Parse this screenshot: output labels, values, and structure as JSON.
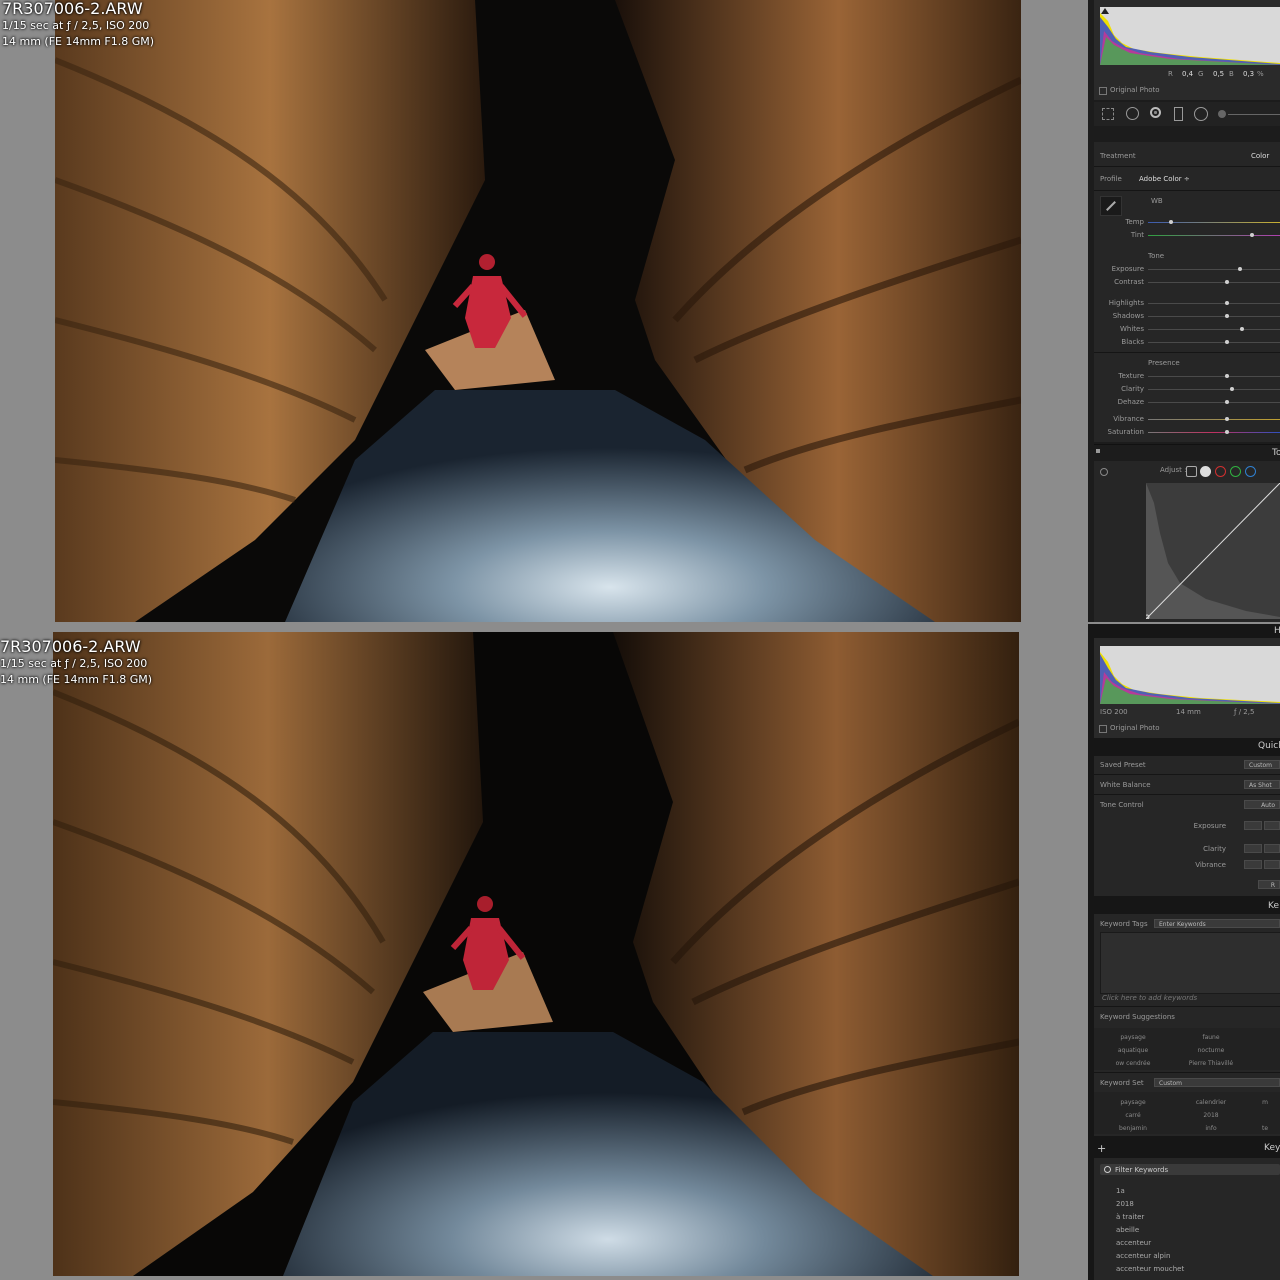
{
  "photos": [
    {
      "filename": "7R307006-2.ARW",
      "exposure": "1/15 sec at ƒ / 2,5, ISO 200",
      "lens": "14 mm (FE 14mm F1.8 GM)"
    },
    {
      "filename": "7R307006-2.ARW",
      "exposure": "1/15 sec at ƒ / 2,5, ISO 200",
      "lens": "14 mm (FE 14mm F1.8 GM)"
    }
  ],
  "develop": {
    "rgb": {
      "r_label": "R",
      "r": "0,4",
      "g_label": "G",
      "g": "0,5",
      "b_label": "B",
      "b": "0,3",
      "unit": "%"
    },
    "original_photo": "Original Photo",
    "treatment_label": "Treatment",
    "treatment_value": "Color",
    "profile_label": "Profile",
    "profile_value": "Adobe Color ÷",
    "wb": "WB",
    "temp": "Temp",
    "tint": "Tint",
    "tone": "Tone",
    "exposure": "Exposure",
    "contrast": "Contrast",
    "highlights": "Highlights",
    "shadows": "Shadows",
    "whites": "Whites",
    "blacks": "Blacks",
    "presence": "Presence",
    "texture": "Texture",
    "clarity": "Clarity",
    "dehaze": "Dehaze",
    "vibrance": "Vibrance",
    "saturation": "Saturation",
    "tone_curve_abbr": "To",
    "adjust": "Adjust :",
    "sliders": {
      "temp": 0.16,
      "tint": 0.77,
      "exposure": 0.68,
      "contrast": 0.58,
      "highlights": 0.58,
      "shadows": 0.58,
      "whites": 0.7,
      "blacks": 0.58,
      "texture": 0.58,
      "clarity": 0.62,
      "dehaze": 0.58,
      "vibrance": 0.58,
      "saturation": 0.58
    }
  },
  "library": {
    "header_h": "H",
    "iso": "ISO 200",
    "focal": "14 mm",
    "aperture": "ƒ / 2,5",
    "original_photo": "Original Photo",
    "quick_develop": "Quick",
    "saved_preset_label": "Saved Preset",
    "saved_preset_value": "Custom",
    "white_balance_label": "White Balance",
    "white_balance_value": "As Shot",
    "tone_control_label": "Tone Control",
    "tone_control_value": "Auto",
    "exposure": "Exposure",
    "clarity": "Clarity",
    "vibrance": "Vibrance",
    "reset": "R",
    "keywording": "Ke",
    "keyword_tags_label": "Keyword Tags",
    "keyword_tags_value": "Enter Keywords",
    "click_to_add": "Click here to add keywords",
    "keyword_suggestions": "Keyword Suggestions",
    "suggestions": [
      "paysage",
      "faune",
      "aquatique",
      "nocturne",
      "ow cendrée",
      "Pierre Thiavillé"
    ],
    "keyword_set_label": "Keyword Set",
    "keyword_set_value": "Custom",
    "set_items": [
      "paysage",
      "calendrier",
      "m",
      "carré",
      "2018",
      "",
      "benjamin",
      "info",
      "te"
    ],
    "keyword_list": "Keyw",
    "plus": "+",
    "filter": "Filter Keywords",
    "keywords": [
      "1a",
      "2018",
      "à traiter",
      "abeille",
      "accenteur",
      "accenteur alpin",
      "accenteur mouchet"
    ]
  },
  "colors": {
    "bg": "#8c8c8c",
    "panel": "#1c1c1c",
    "row": "#262626",
    "rock": "#9a6a3c",
    "water": "#8fa8b8",
    "suit": "#c8283c"
  }
}
